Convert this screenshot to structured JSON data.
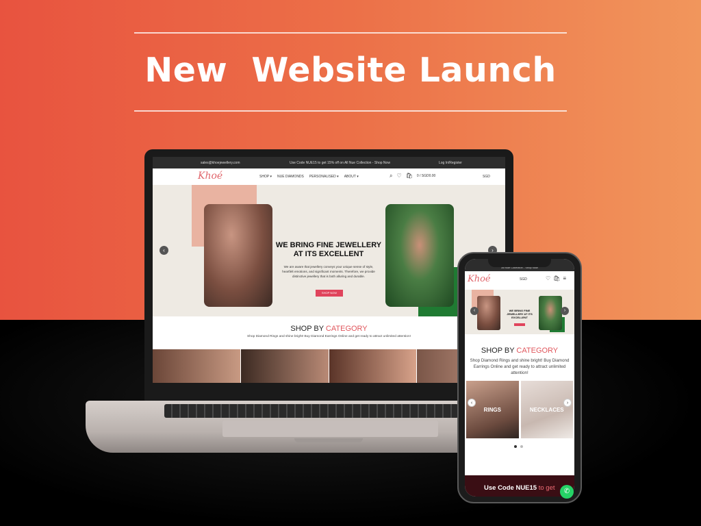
{
  "banner": {
    "headline": "New  Website Launch"
  },
  "desktop_site": {
    "topbar": {
      "email": "sales@khoejewellery.com",
      "promo": "Use Code NUE15 to get 15% off on All Nue Collection - Shop Now",
      "login": "Log In/Register"
    },
    "logo": "Khoé",
    "menu": [
      "SHOP ▾",
      "NUE DIAMONDS",
      "PERSONALISED ▾",
      "ABOUT ▾"
    ],
    "cart_label": "0 / SGD0.00",
    "currency": "SGD",
    "hero": {
      "title": "WE BRING FINE JEWELLERY AT ITS EXCELLENT",
      "text": "We are aware that jewellery conveys your unique sense of style, heartfelt emotions, and significant moments. Therefore, we provide distinctive jewellery that is both alluring and durable.",
      "button": "SHOP NOW"
    },
    "shop_by": {
      "title_prefix": "SHOP BY ",
      "title_accent": "CATEGORY",
      "subtitle": "Shop Diamond Rings and shine bright! Buy Diamond Earrings Online and get ready to attract unlimited attention!"
    }
  },
  "mobile_site": {
    "topbar": "All Nue Collection - Shop Now",
    "logo": "Khoé",
    "currency": "SGD",
    "hero_title": "WE BRING FINE JEWELLERY AT ITS EXCELLENT",
    "shop_by": {
      "title_prefix": "SHOP BY ",
      "title_accent": "CATEGORY",
      "subtitle": "Shop Diamond Rings and shine bright! Buy Diamond Earrings Online and get ready to attract unlimited attention!"
    },
    "categories": [
      "RINGS",
      "NECKLACES"
    ],
    "promo_prefix": "Use Code NUE15 ",
    "promo_accent": "to get"
  },
  "icons": {
    "search": "⌕",
    "wishlist": "♡",
    "cart": "🛍",
    "menu": "≡",
    "arrow_left": "‹",
    "arrow_right": "›",
    "whatsapp": "✆"
  },
  "colors": {
    "gradient_start": "#e8533f",
    "gradient_end": "#f1965c",
    "accent": "#e0565c",
    "logo": "#e0656b",
    "hero_button": "#e0445c",
    "promo_bar": "#3a0e14"
  }
}
